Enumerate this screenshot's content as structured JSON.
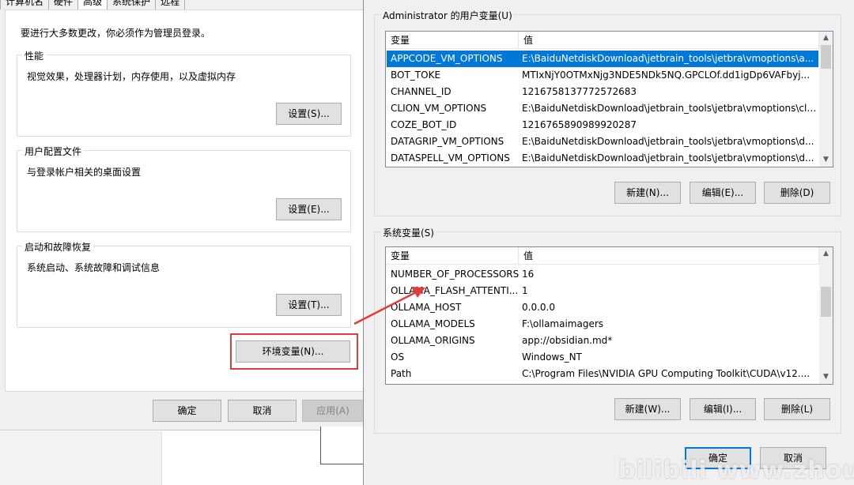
{
  "system_properties": {
    "tabs": [
      "计算机名",
      "硬件",
      "高级",
      "系统保护",
      "远程"
    ],
    "active_tab": "高级",
    "admin_note": "要进行大多数更改，你必须作为管理员登录。",
    "performance": {
      "title": "性能",
      "desc": "视觉效果，处理器计划，内存使用，以及虚拟内存",
      "button": "设置(S)..."
    },
    "user_profiles": {
      "title": "用户配置文件",
      "desc": "与登录帐户相关的桌面设置",
      "button": "设置(E)..."
    },
    "startup_recovery": {
      "title": "启动和故障恢复",
      "desc": "系统启动、系统故障和调试信息",
      "button": "设置(T)..."
    },
    "env_button": "环境变量(N)...",
    "ok": "确定",
    "cancel": "取消",
    "apply": "应用(A)"
  },
  "env_dialog": {
    "user_vars": {
      "title": "Administrator 的用户变量(U)",
      "col_var": "变量",
      "col_val": "值",
      "rows": [
        {
          "name": "APPCODE_VM_OPTIONS",
          "value": "E:\\BaiduNetdiskDownload\\jetbrain_tools\\jetbra\\vmoptions\\a...",
          "selected": true
        },
        {
          "name": "BOT_TOKE",
          "value": "MTIxNjY0OTMxNjg3NDE5NDk5NQ.GPCLOf.dd1igDp6VAFbyj..."
        },
        {
          "name": "CHANNEL_ID",
          "value": "1216758137772572683"
        },
        {
          "name": "CLION_VM_OPTIONS",
          "value": "E:\\BaiduNetdiskDownload\\jetbrain_tools\\jetbra\\vmoptions\\cli..."
        },
        {
          "name": "COZE_BOT_ID",
          "value": "1216765890989920287"
        },
        {
          "name": "DATAGRIP_VM_OPTIONS",
          "value": "E:\\BaiduNetdiskDownload\\jetbrain_tools\\jetbra\\vmoptions\\d..."
        },
        {
          "name": "DATASPELL_VM_OPTIONS",
          "value": "E:\\BaiduNetdiskDownload\\jetbrain_tools\\jetbra\\vmoptions\\d..."
        }
      ],
      "new_btn": "新建(N)...",
      "edit_btn": "编辑(E)...",
      "delete_btn": "删除(D)"
    },
    "system_vars": {
      "title": "系统变量(S)",
      "col_var": "变量",
      "col_val": "值",
      "rows": [
        {
          "name": "NUMBER_OF_PROCESSORS",
          "value": "16"
        },
        {
          "name": "OLLAMA_FLASH_ATTENTI...",
          "value": "1"
        },
        {
          "name": "OLLAMA_HOST",
          "value": "0.0.0.0"
        },
        {
          "name": "OLLAMA_MODELS",
          "value": "F:\\ollamaimagers"
        },
        {
          "name": "OLLAMA_ORIGINS",
          "value": "app://obsidian.md*"
        },
        {
          "name": "OS",
          "value": "Windows_NT"
        },
        {
          "name": "Path",
          "value": "C:\\Program Files\\NVIDIA GPU Computing Toolkit\\CUDA\\v12...."
        }
      ],
      "new_btn": "新建(W)...",
      "edit_btn": "编辑(I)...",
      "delete_btn": "删除(L)"
    },
    "ok": "确定",
    "cancel": "取消"
  },
  "watermark": "bilibili www.zhouhu",
  "colors": {
    "selection": "#0078d7",
    "highlight": "#e23b3b"
  }
}
